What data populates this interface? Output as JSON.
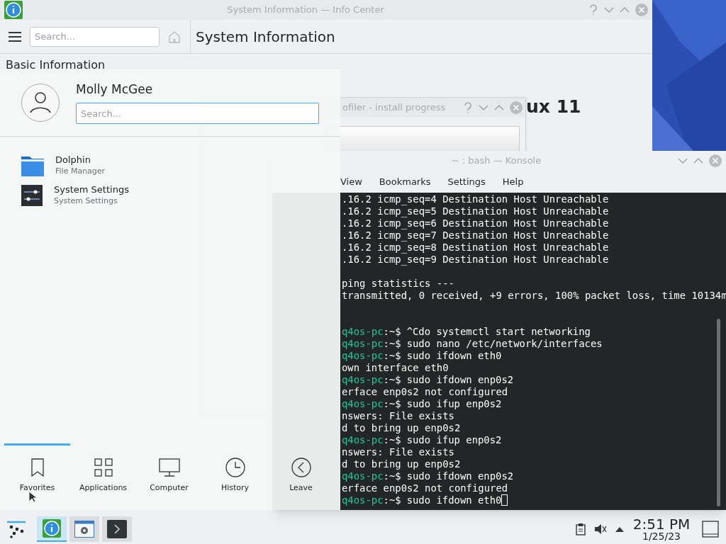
{
  "info_center": {
    "title": "System Information — Info Center",
    "search": {
      "placeholder": "Search..."
    },
    "page_title": "System Information",
    "sidebar_heading": "Basic Information",
    "content_heading": "ux 11"
  },
  "install_dialog": {
    "title": "ofiler - install progress"
  },
  "konsole": {
    "title": "~ : bash — Konsole",
    "menu": [
      "View",
      "Bookmarks",
      "Settings",
      "Help"
    ],
    "lines": [
      {
        "kind": "output",
        "text": ".16.2 icmp_seq=4 Destination Host Unreachable"
      },
      {
        "kind": "output",
        "text": ".16.2 icmp_seq=5 Destination Host Unreachable"
      },
      {
        "kind": "output",
        "text": ".16.2 icmp_seq=6 Destination Host Unreachable"
      },
      {
        "kind": "output",
        "text": ".16.2 icmp_seq=7 Destination Host Unreachable"
      },
      {
        "kind": "output",
        "text": ".16.2 icmp_seq=8 Destination Host Unreachable"
      },
      {
        "kind": "output",
        "text": ".16.2 icmp_seq=9 Destination Host Unreachable"
      },
      {
        "kind": "blank"
      },
      {
        "kind": "output",
        "text": "ping statistics ---"
      },
      {
        "kind": "output",
        "text": "transmitted, 0 received, +9 errors, 100% packet loss, time 10134m"
      },
      {
        "kind": "blank"
      },
      {
        "kind": "blank"
      },
      {
        "kind": "prompt",
        "host": "q4os-pc",
        "path": ":~$",
        "command": "^Cdo systemctl start networking",
        "cursor": false
      },
      {
        "kind": "prompt",
        "host": "q4os-pc",
        "path": ":~$",
        "command": "sudo nano /etc/network/interfaces",
        "cursor": false
      },
      {
        "kind": "prompt",
        "host": "q4os-pc",
        "path": ":~$",
        "command": "sudo ifdown eth0",
        "cursor": false
      },
      {
        "kind": "output",
        "text": "own interface eth0"
      },
      {
        "kind": "prompt",
        "host": "q4os-pc",
        "path": ":~$",
        "command": "sudo ifdown enp0s2",
        "cursor": false
      },
      {
        "kind": "output",
        "text": "erface enp0s2 not configured"
      },
      {
        "kind": "prompt",
        "host": "q4os-pc",
        "path": ":~$",
        "command": "sudo ifup enp0s2",
        "cursor": false
      },
      {
        "kind": "output",
        "text": "nswers: File exists"
      },
      {
        "kind": "output",
        "text": "d to bring up enp0s2"
      },
      {
        "kind": "prompt",
        "host": "q4os-pc",
        "path": ":~$",
        "command": "sudo ifup enp0s2",
        "cursor": false
      },
      {
        "kind": "output",
        "text": "nswers: File exists"
      },
      {
        "kind": "output",
        "text": "d to bring up enp0s2"
      },
      {
        "kind": "prompt",
        "host": "q4os-pc",
        "path": ":~$",
        "command": "sudo ifdown enp0s2",
        "cursor": false
      },
      {
        "kind": "output",
        "text": "erface enp0s2 not configured"
      },
      {
        "kind": "prompt",
        "host": "q4os-pc",
        "path": ":~$",
        "command": "sudo ifdown eth0",
        "cursor": true
      }
    ]
  },
  "launcher": {
    "user": "Molly McGee",
    "search": {
      "placeholder": "Search..."
    },
    "favorites": [
      {
        "name": "Dolphin",
        "description": "File Manager",
        "kind": "folder"
      },
      {
        "name": "System Settings",
        "description": "System Settings",
        "kind": "settings"
      }
    ],
    "tabs": [
      {
        "label": "Favorites",
        "kind": "bookmark",
        "selected": true
      },
      {
        "label": "Applications",
        "kind": "grid",
        "selected": false
      },
      {
        "label": "Computer",
        "kind": "monitor",
        "selected": false
      },
      {
        "label": "History",
        "kind": "clock",
        "selected": false
      },
      {
        "label": "Leave",
        "kind": "leave",
        "selected": false
      }
    ]
  },
  "taskbar": {
    "tasks": [
      {
        "kind": "info",
        "selected": true
      },
      {
        "kind": "settings",
        "selected": false
      },
      {
        "kind": "terminal",
        "selected": false
      }
    ],
    "clock": {
      "time": "2:51 PM",
      "date": "1/25/23"
    }
  }
}
